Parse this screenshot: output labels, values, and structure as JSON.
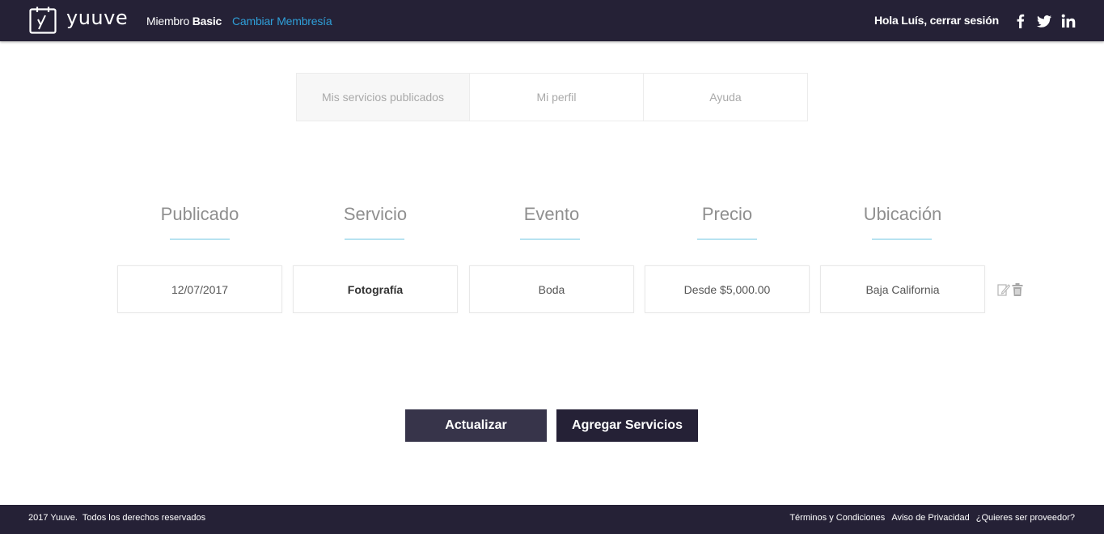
{
  "header": {
    "logo_text": "yuuve",
    "member_prefix": "Miembro",
    "member_plan": "Basic",
    "change_membership": "Cambiar Membresía",
    "greeting": "Hola Luís, cerrar sesión",
    "social_icons": [
      "facebook-icon",
      "twitter-icon",
      "linkedin-icon"
    ]
  },
  "tabs": [
    {
      "label": "Mis servicios publicados",
      "active": true
    },
    {
      "label": "Mi perfil",
      "active": false
    },
    {
      "label": "Ayuda",
      "active": false
    }
  ],
  "table": {
    "columns": [
      "Publicado",
      "Servicio",
      "Evento",
      "Precio",
      "Ubicación"
    ],
    "rows": [
      [
        "12/07/2017",
        "Fotografía",
        "Boda",
        "Desde $5,000.00",
        "Baja California"
      ]
    ],
    "row_actions": [
      "edit-icon",
      "trash-icon"
    ]
  },
  "buttons": {
    "update": "Actualizar",
    "add_services": "Agregar Servicios"
  },
  "footer": {
    "copyright": "2017 Yuuve.  Todos los derechos reservados",
    "links": [
      "Términos y Condiciones",
      "Aviso de Privacidad",
      "¿Quieres ser proveedor?"
    ]
  },
  "colors": {
    "header_bg": "#252136",
    "accent": "#2f9fd8",
    "underline": "#6ec6e2",
    "button_update": "#37344a",
    "button_add": "#252136"
  }
}
